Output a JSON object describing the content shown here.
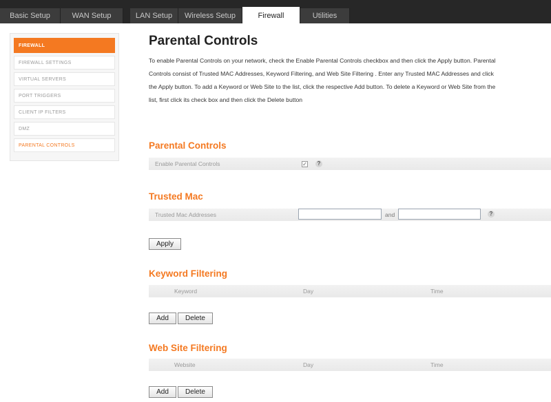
{
  "tabs": [
    {
      "label": "Basic Setup",
      "active": false
    },
    {
      "label": "WAN Setup",
      "active": false
    },
    {
      "label": "LAN Setup",
      "active": false
    },
    {
      "label": "Wireless Setup",
      "active": false
    },
    {
      "label": "Firewall",
      "active": true
    },
    {
      "label": "Utilities",
      "active": false
    }
  ],
  "sidebar": {
    "header": "FIREWALL",
    "items": [
      {
        "label": "FIREWALL SETTINGS",
        "selected": false
      },
      {
        "label": "VIRTUAL SERVERS",
        "selected": false
      },
      {
        "label": "PORT TRIGGERS",
        "selected": false
      },
      {
        "label": "CLIENT IP FILTERS",
        "selected": false
      },
      {
        "label": "DMZ",
        "selected": false
      },
      {
        "label": "PARENTAL CONTROLS",
        "selected": true
      }
    ]
  },
  "page": {
    "title": "Parental Controls",
    "intro_lines": [
      "To enable Parental Controls on your network, check the Enable Parental Controls checkbox and then click the Apply button. Parental",
      "Controls consist of Trusted MAC Addresses, Keyword Filtering, and Web Site Filtering . Enter any Trusted MAC Addresses and click",
      "the Apply button. To add a Keyword or Web Site to the list, click the respective Add button. To delete a Keyword or Web Site from the",
      "list, first click its check box and then click the Delete button"
    ]
  },
  "parental": {
    "section_title": "Parental Controls",
    "enable_label": "Enable Parental Controls",
    "enabled": true,
    "check_glyph": "✓",
    "help_glyph": "?"
  },
  "trusted": {
    "section_title": "Trusted Mac",
    "label": "Trusted Mac Addresses",
    "and_label": "and",
    "mac1_value": "",
    "mac2_value": "",
    "help_glyph": "?",
    "apply_label": "Apply"
  },
  "keyword": {
    "section_title": "Keyword Filtering",
    "col_keyword": "Keyword",
    "col_day": "Day",
    "col_time": "Time",
    "add_label": "Add",
    "delete_label": "Delete"
  },
  "website": {
    "section_title": "Web Site Filtering",
    "col_website": "Website",
    "col_day": "Day",
    "col_time": "Time",
    "add_label": "Add",
    "delete_label": "Delete"
  },
  "colors": {
    "accent": "#f47921",
    "topbar": "#272727",
    "tab_inactive": "#3c3c3c"
  }
}
